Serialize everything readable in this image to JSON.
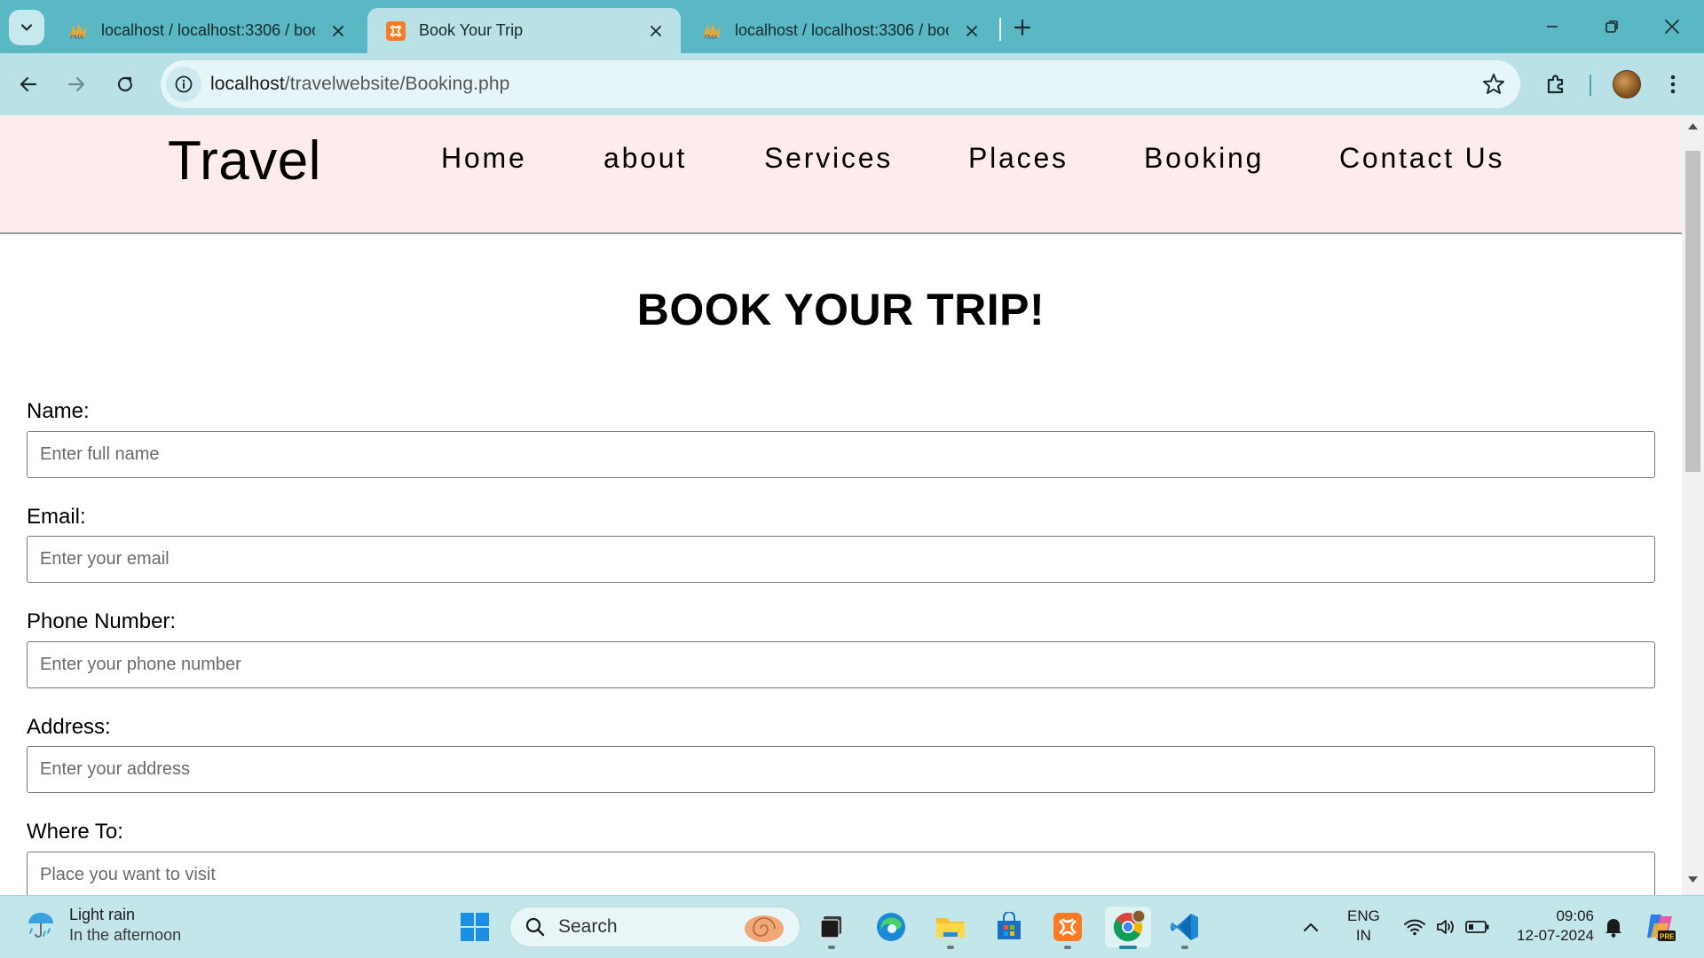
{
  "browser": {
    "tabs": [
      {
        "title": "localhost / localhost:3306 / boo",
        "active": false,
        "favicon": "phpmyadmin-icon"
      },
      {
        "title": "Book Your Trip",
        "active": true,
        "favicon": "xampp-icon"
      },
      {
        "title": "localhost / localhost:3306 / boo",
        "active": false,
        "favicon": "phpmyadmin-icon"
      }
    ],
    "url_host": "localhost",
    "url_path": "/travelwebsite/Booking.php"
  },
  "site": {
    "logo": "Travel",
    "nav": [
      "Home",
      "about",
      "Services",
      "Places",
      "Booking",
      "Contact Us"
    ]
  },
  "form": {
    "title": "BOOK YOUR TRIP!",
    "fields": [
      {
        "label": "Name:",
        "placeholder": "Enter full name"
      },
      {
        "label": "Email:",
        "placeholder": "Enter your email"
      },
      {
        "label": "Phone Number:",
        "placeholder": "Enter your phone number"
      },
      {
        "label": "Address:",
        "placeholder": "Enter your address"
      },
      {
        "label": "Where To:",
        "placeholder": "Place you want to visit"
      }
    ]
  },
  "taskbar": {
    "weather_title": "Light rain",
    "weather_sub": "In the afternoon",
    "search_label": "Search",
    "lang_top": "ENG",
    "lang_bottom": "IN",
    "time": "09:06",
    "date": "12-07-2024"
  },
  "colors": {
    "tabstrip": "#5ab8c4",
    "toolbar": "#b9e1e6",
    "header_bg": "#fdeceb",
    "taskbar": "#c3e6ea"
  }
}
